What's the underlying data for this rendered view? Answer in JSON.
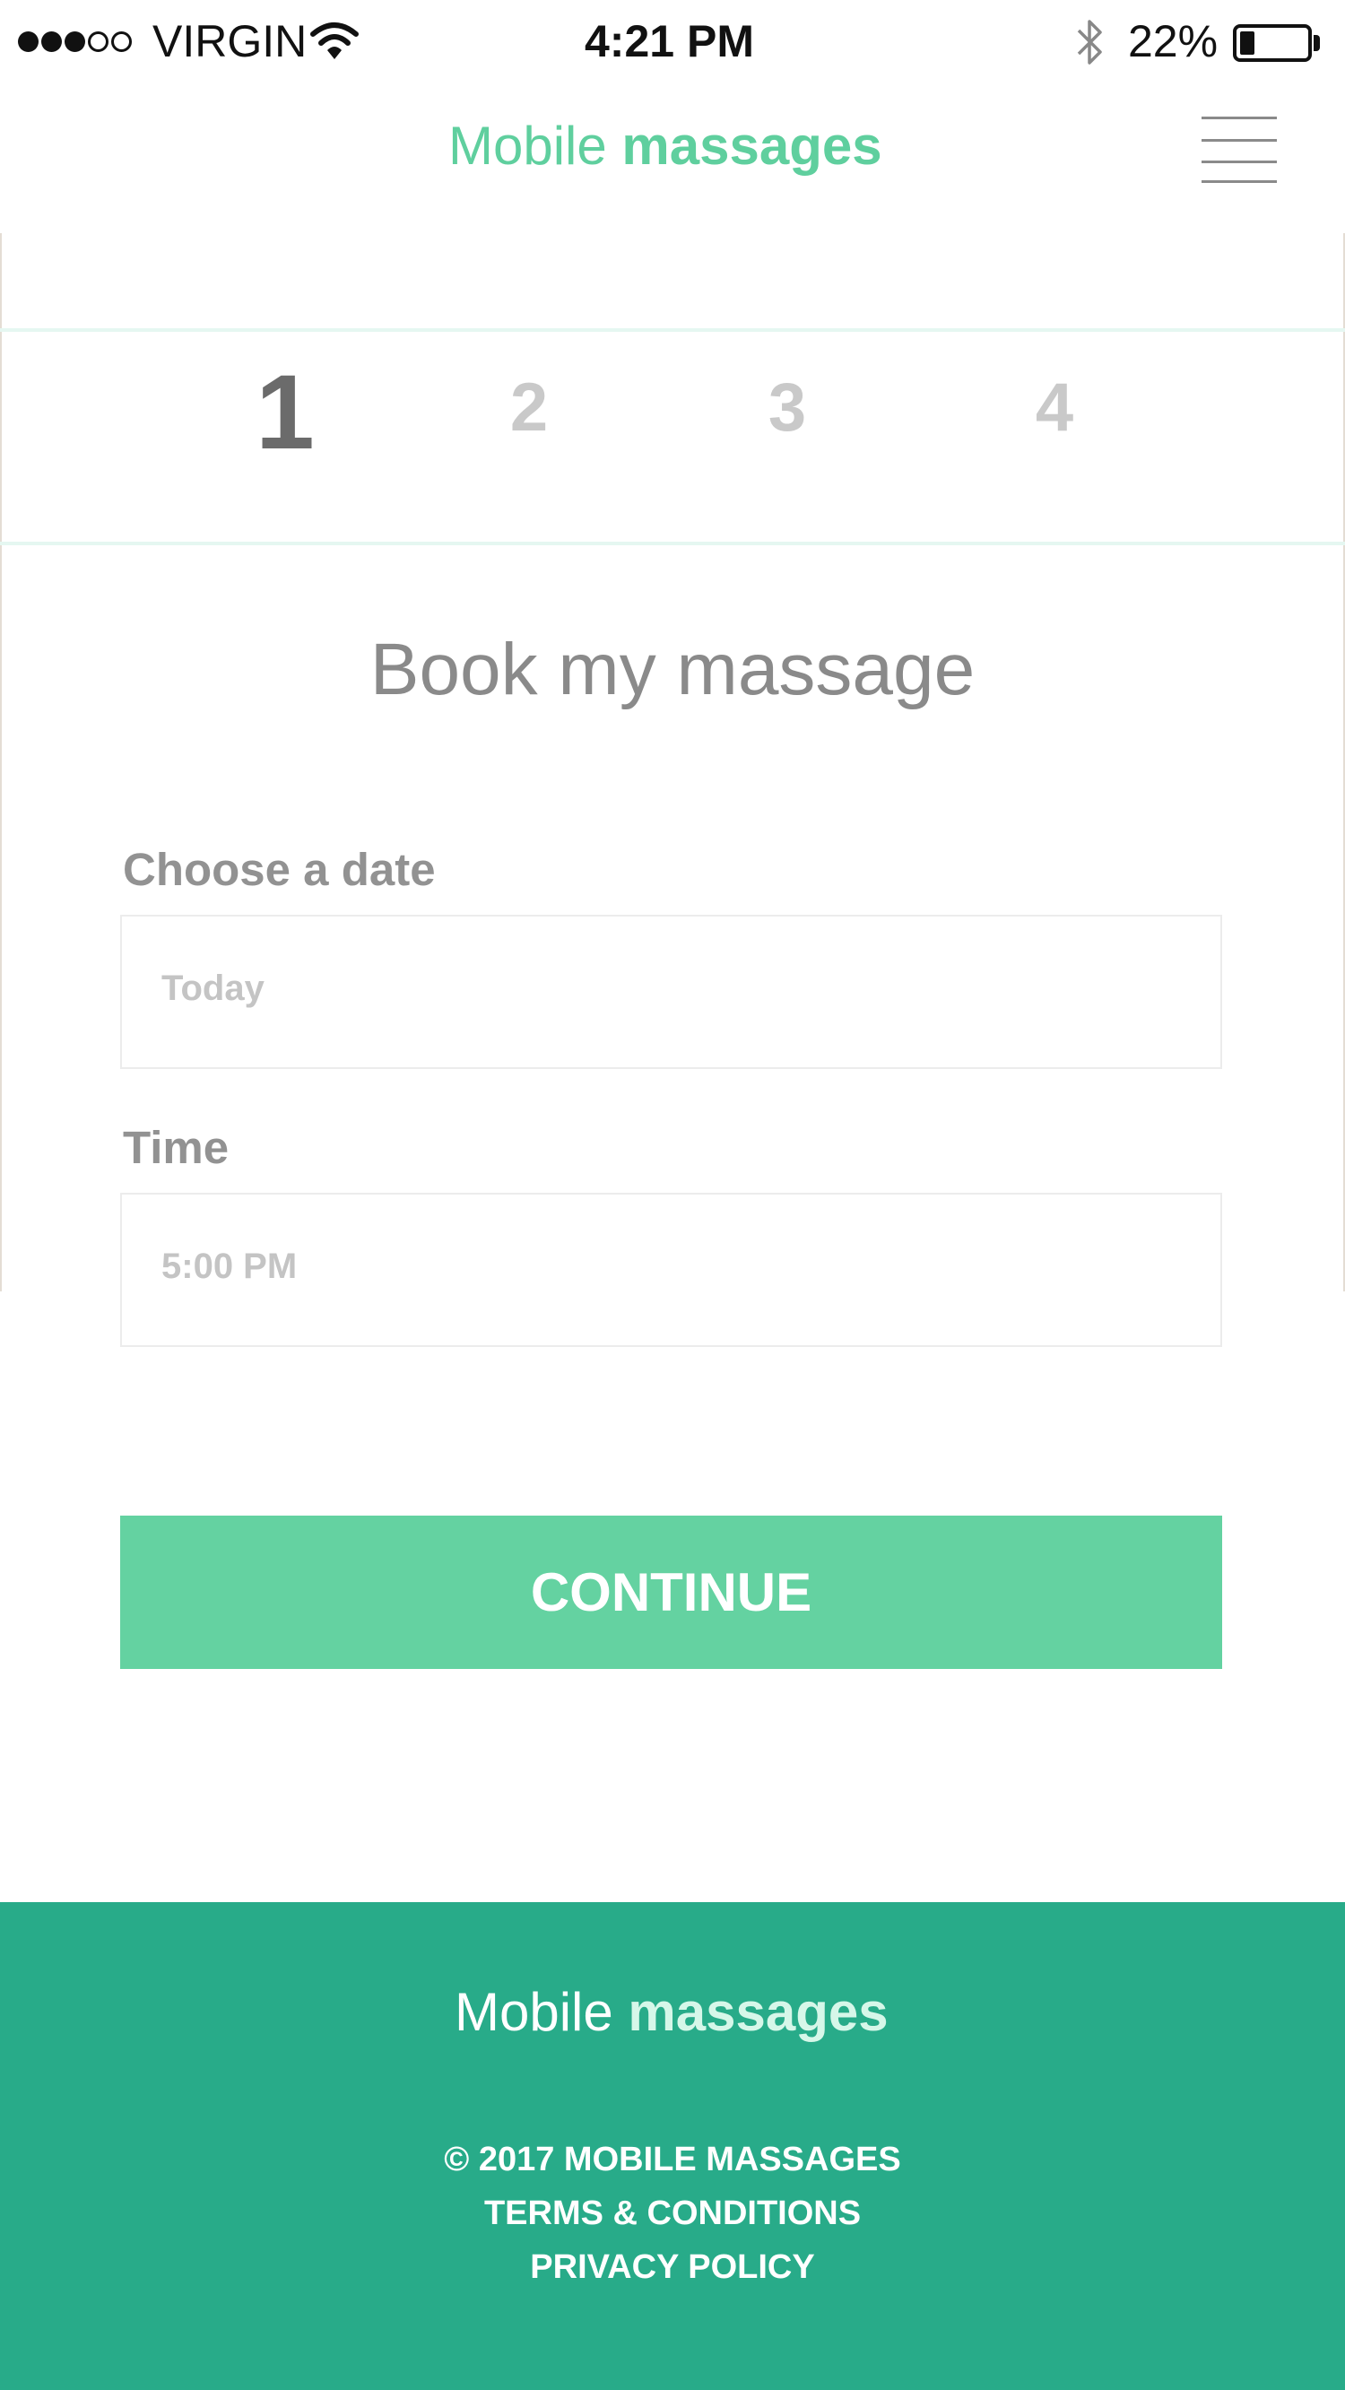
{
  "status_bar": {
    "carrier": "VIRGIN",
    "time": "4:21 PM",
    "battery_percent": "22%",
    "battery_level": 0.22,
    "icons": [
      "signal-dots-icon",
      "wifi-icon",
      "bluetooth-icon",
      "battery-icon"
    ]
  },
  "header": {
    "logo_light": "Mobile",
    "logo_bold": "massages",
    "menu_icon": "hamburger-menu-icon"
  },
  "steps": [
    {
      "label": "1",
      "active": true
    },
    {
      "label": "2",
      "active": false
    },
    {
      "label": "3",
      "active": false
    },
    {
      "label": "4",
      "active": false
    }
  ],
  "form": {
    "title": "Book my massage",
    "date_label": "Choose a date",
    "date_value": "Today",
    "time_label": "Time",
    "time_value": "5:00 PM",
    "continue_label": "CONTINUE"
  },
  "footer": {
    "logo_light": "Mobile",
    "logo_bold": "massages",
    "copyright": "© 2017 MOBILE MASSAGES",
    "terms": "TERMS & CONDITIONS",
    "privacy": "PRIVACY POLICY"
  },
  "colors": {
    "accent": "#64d2a1",
    "footer_bg": "#28ab89",
    "logo_header": "#5fcf9e",
    "logo_footer_bold": "#d6f7e9"
  }
}
